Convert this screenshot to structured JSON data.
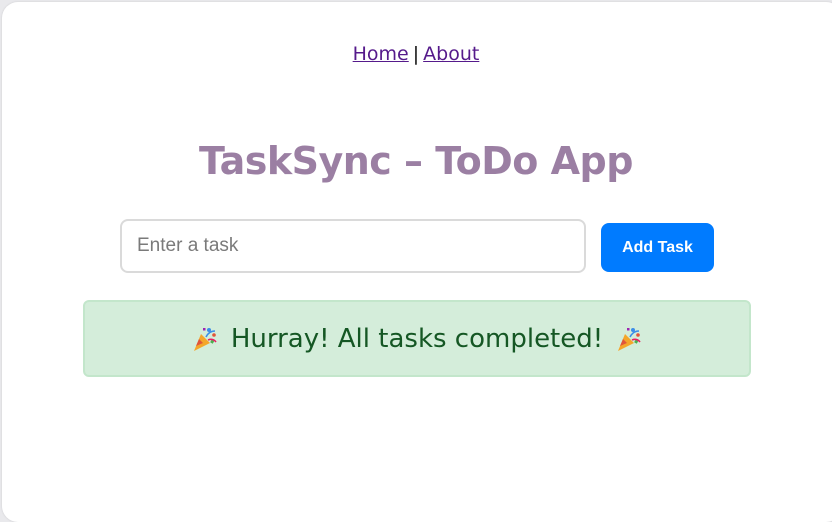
{
  "nav": {
    "home_label": "Home",
    "separator": "|",
    "about_label": "About"
  },
  "header": {
    "title": "TaskSync – ToDo App"
  },
  "task_form": {
    "input_value": "",
    "input_placeholder": "Enter a task",
    "add_button_label": "Add Task"
  },
  "status": {
    "message": "Hurray! All tasks completed!",
    "leading_icon": "party-popper-icon",
    "trailing_icon": "party-popper-icon"
  },
  "colors": {
    "title": "#9b7fa3",
    "button": "#007bff",
    "banner_bg": "#d4edda",
    "banner_text": "#155724",
    "link": "#551a8b"
  }
}
